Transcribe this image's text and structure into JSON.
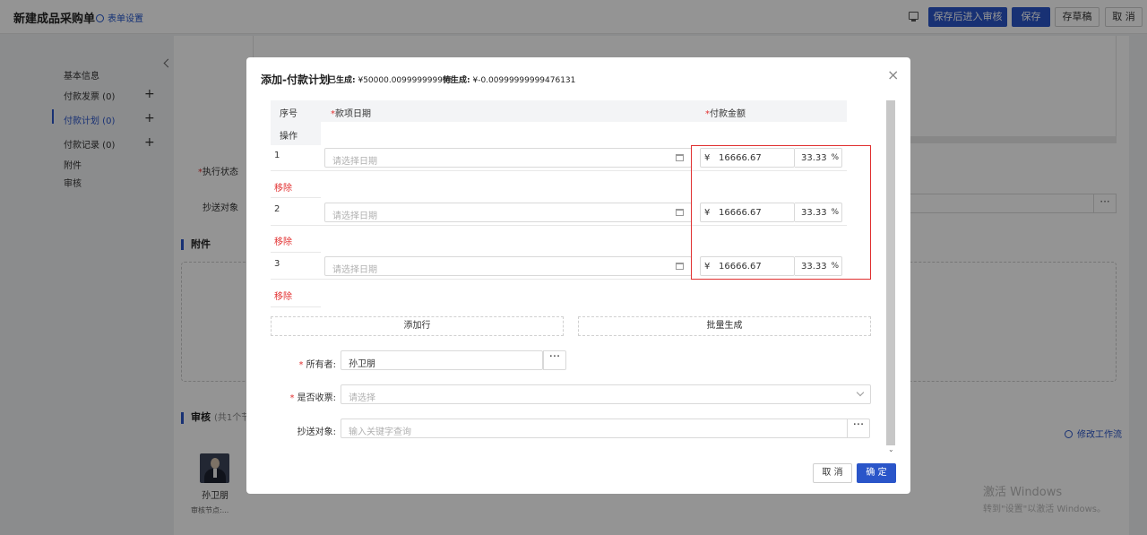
{
  "header": {
    "title": "新建成品采购单",
    "form_settings": "表单设置",
    "buttons": {
      "submit_review": "保存后进入审核",
      "save": "保存",
      "draft": "存草稿",
      "cancel": "取 消"
    }
  },
  "left_nav": {
    "items": [
      {
        "label": "基本信息"
      },
      {
        "label": "付款发票 (0)"
      },
      {
        "label": "付款计划 (0)"
      },
      {
        "label": "付款记录 (0)"
      },
      {
        "label": "附件"
      },
      {
        "label": "审核"
      }
    ]
  },
  "background_form": {
    "exec_status_label": "执行状态",
    "cc_label": "抄送对象",
    "cc_dots": "···",
    "attachment_title": "附件",
    "review_title": "审核",
    "review_sub": "(共1个节",
    "workflow_link": "修改工作流",
    "reviewer_name": "孙卫朋",
    "review_node": "审核节点:..."
  },
  "watermark": {
    "line1": "激活 Windows",
    "line2": "转到\"设置\"以激活 Windows。"
  },
  "modal": {
    "title": "添加-付款计划",
    "generated_label": "已生成:",
    "generated_value": "¥50000.009999999995",
    "pending_label": "待生成:",
    "pending_value": "¥-0.00999999999476131",
    "table": {
      "col_index": "序号",
      "col_date": "款项日期",
      "col_amount": "付款金额",
      "col_action": "操作",
      "rows": [
        {
          "index": "1",
          "date_placeholder": "请选择日期",
          "currency": "¥",
          "amount": "16666.67",
          "percent": "33.33",
          "percent_unit": "%",
          "remove": "移除"
        },
        {
          "index": "2",
          "date_placeholder": "请选择日期",
          "currency": "¥",
          "amount": "16666.67",
          "percent": "33.33",
          "percent_unit": "%",
          "remove": "移除"
        },
        {
          "index": "3",
          "date_placeholder": "请选择日期",
          "currency": "¥",
          "amount": "16666.67",
          "percent": "33.33",
          "percent_unit": "%",
          "remove": "移除"
        }
      ]
    },
    "add_row": "添加行",
    "batch_generate": "批量生成",
    "owner_label": "所有者:",
    "owner_value": "孙卫朋",
    "invoice_label": "是否收票:",
    "invoice_placeholder": "请选择",
    "cc_label": "抄送对象:",
    "cc_placeholder": "输入关键字查询",
    "dots": "···",
    "cancel_btn": "取 消",
    "ok_btn": "确 定"
  },
  "colors": {
    "primary": "#2a55c9",
    "danger": "#e23030",
    "highlight_border": "#e03030"
  }
}
